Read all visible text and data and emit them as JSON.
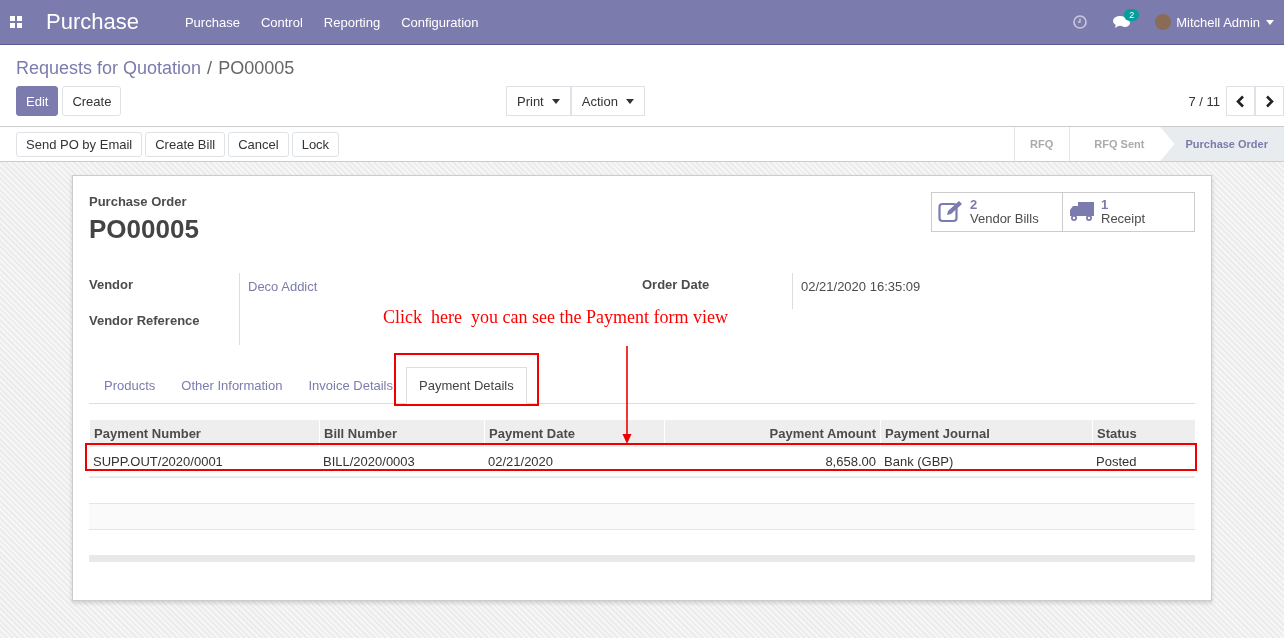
{
  "navbar": {
    "app_name": "Purchase",
    "menu": [
      "Purchase",
      "Control",
      "Reporting",
      "Configuration"
    ],
    "messages_count": "2",
    "user": "Mitchell Admin"
  },
  "breadcrumb": {
    "parent": "Requests for Quotation",
    "separator": "/",
    "current": "PO00005"
  },
  "control_buttons": [
    {
      "label": "Edit",
      "primary": true
    },
    {
      "label": "Create",
      "primary": false
    }
  ],
  "dropdowns": [
    "Print",
    "Action"
  ],
  "pager": "7 / 11",
  "header_buttons": [
    "Send PO by Email",
    "Create Bill",
    "Cancel",
    "Lock"
  ],
  "stages": [
    {
      "label": "RFQ",
      "selected": false
    },
    {
      "label": "RFQ Sent",
      "selected": false
    },
    {
      "label": "Purchase Order",
      "selected": true
    }
  ],
  "sheet": {
    "subtitle": "Purchase Order",
    "title": "PO00005",
    "smart_buttons": [
      {
        "kind": "bills",
        "count": "2",
        "label": "Vendor Bills"
      },
      {
        "kind": "receipt",
        "count": "1",
        "label": "Receipt"
      }
    ],
    "left_fields": [
      {
        "label": "Vendor",
        "value": "Deco Addict"
      },
      {
        "label": "Vendor Reference"
      }
    ],
    "right_fields": [
      {
        "label": "Order Date",
        "value": "02/21/2020 16:35:09"
      }
    ],
    "tabs": [
      {
        "label": "Products",
        "selected": false
      },
      {
        "label": "Other Information",
        "selected": false
      },
      {
        "label": "Invoice Details",
        "selected": false
      },
      {
        "label": "Payment Details",
        "selected": true
      }
    ],
    "table": {
      "columns": [
        {
          "label": "Payment Number",
          "kind": "text"
        },
        {
          "label": "Bill Number",
          "kind": "text"
        },
        {
          "label": "Payment Date",
          "kind": "text"
        },
        {
          "label": "Payment Amount",
          "kind": "number"
        },
        {
          "label": "Payment Journal",
          "kind": "text"
        },
        {
          "label": "Status",
          "kind": "text"
        }
      ],
      "rows": [
        [
          "SUPP.OUT/2020/0001",
          "BILL/2020/0003",
          "02/21/2020",
          "8,658.00",
          "Bank (GBP)",
          "Posted"
        ]
      ]
    }
  },
  "annotation": {
    "parts": [
      "Click",
      "here",
      "you can see the Payment form view"
    ]
  }
}
